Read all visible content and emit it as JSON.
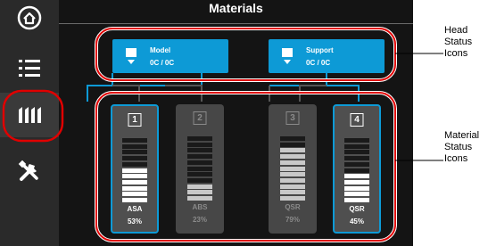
{
  "screen_title": "Materials",
  "sidebar": {
    "items": [
      {
        "name": "home",
        "icon": "home-icon"
      },
      {
        "name": "menu",
        "icon": "menu-icon"
      },
      {
        "name": "materials",
        "icon": "material-bays-icon",
        "active": true
      },
      {
        "name": "tools",
        "icon": "tools-icon"
      }
    ]
  },
  "heads": [
    {
      "label": "Model",
      "temp": "0C / 0C"
    },
    {
      "label": "Support",
      "temp": "0C / 0C"
    }
  ],
  "bays": [
    {
      "number": "1",
      "material": "ASA",
      "level": "53%",
      "active": true
    },
    {
      "number": "2",
      "material": "ABS",
      "level": "23%",
      "active": false
    },
    {
      "number": "3",
      "material": "QSR",
      "level": "79%",
      "active": false
    },
    {
      "number": "4",
      "material": "QSR",
      "level": "45%",
      "active": true
    }
  ],
  "callouts": {
    "head": [
      "Head",
      "Status",
      "Icons"
    ],
    "material": [
      "Material",
      "Status",
      "Icons"
    ]
  },
  "colors": {
    "accent": "#0d9ad6",
    "highlight": "#e00000",
    "background": "#141414"
  }
}
